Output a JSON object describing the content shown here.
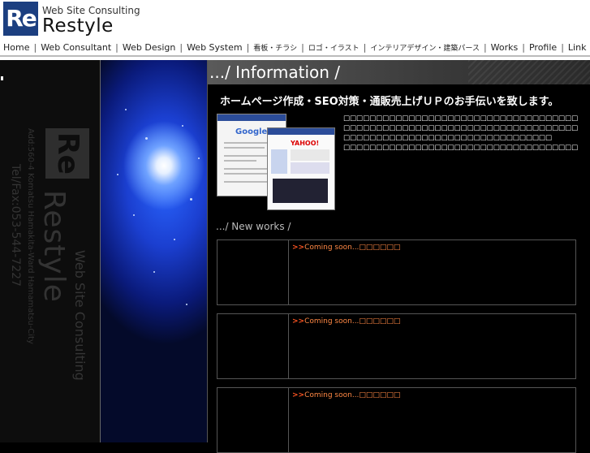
{
  "header": {
    "logo_mark": "Re",
    "tagline": "Web Site Consulting",
    "brand": "Restyle"
  },
  "nav": [
    {
      "label": "Home"
    },
    {
      "label": "Web Consultant"
    },
    {
      "label": "Web Design"
    },
    {
      "label": "Web System"
    },
    {
      "label": "看板・チラシ"
    },
    {
      "label": "ロゴ・イラスト"
    },
    {
      "label": "インテリアデザイン・建築パース"
    },
    {
      "label": "Works"
    },
    {
      "label": "Profile"
    },
    {
      "label": "Link"
    }
  ],
  "sidebar": {
    "logo_mark": "Re",
    "brand": "Restyle",
    "tagline": "Web Site Consulting",
    "address": "Add:560-4 Komatsu Hamakita-Ward Hamamatsu-City",
    "telfax": "Tel/Fax:053-544-7227"
  },
  "main": {
    "section_title": ".../ Information /",
    "headline": "ホームページ作成・SEO対策・通販売上げＵＰのお手伝いを致します。",
    "screenshot1_logo": "Google",
    "screenshot2_logo": "YAHOO!",
    "description": [
      "□□□□□□□□□□□□□□□□□□□□□□□□□□□□□□□□□□□□□□□□□□□□□□",
      "□□□□□□□□□□□□□□□□□□□□□□□□□□□□□□□□□□□□□□□□",
      "□□□□□□□□□□□□□□□□□□□□□□□□□□□□□□□□",
      "□□□□□□□□□□□□□□□□□□□□□□□□□□□□□□□□□□□□□□□□□□"
    ],
    "new_works_title": ".../ New works /",
    "works": [
      {
        "arrow": ">>",
        "text": "Coming soon...□□□□□□"
      },
      {
        "arrow": ">>",
        "text": "Coming soon...□□□□□□"
      },
      {
        "arrow": ">>",
        "text": "Coming soon...□□□□□□"
      }
    ]
  },
  "colors": {
    "brand_blue": "#1c3f80",
    "link_orange": "#ff8844"
  }
}
